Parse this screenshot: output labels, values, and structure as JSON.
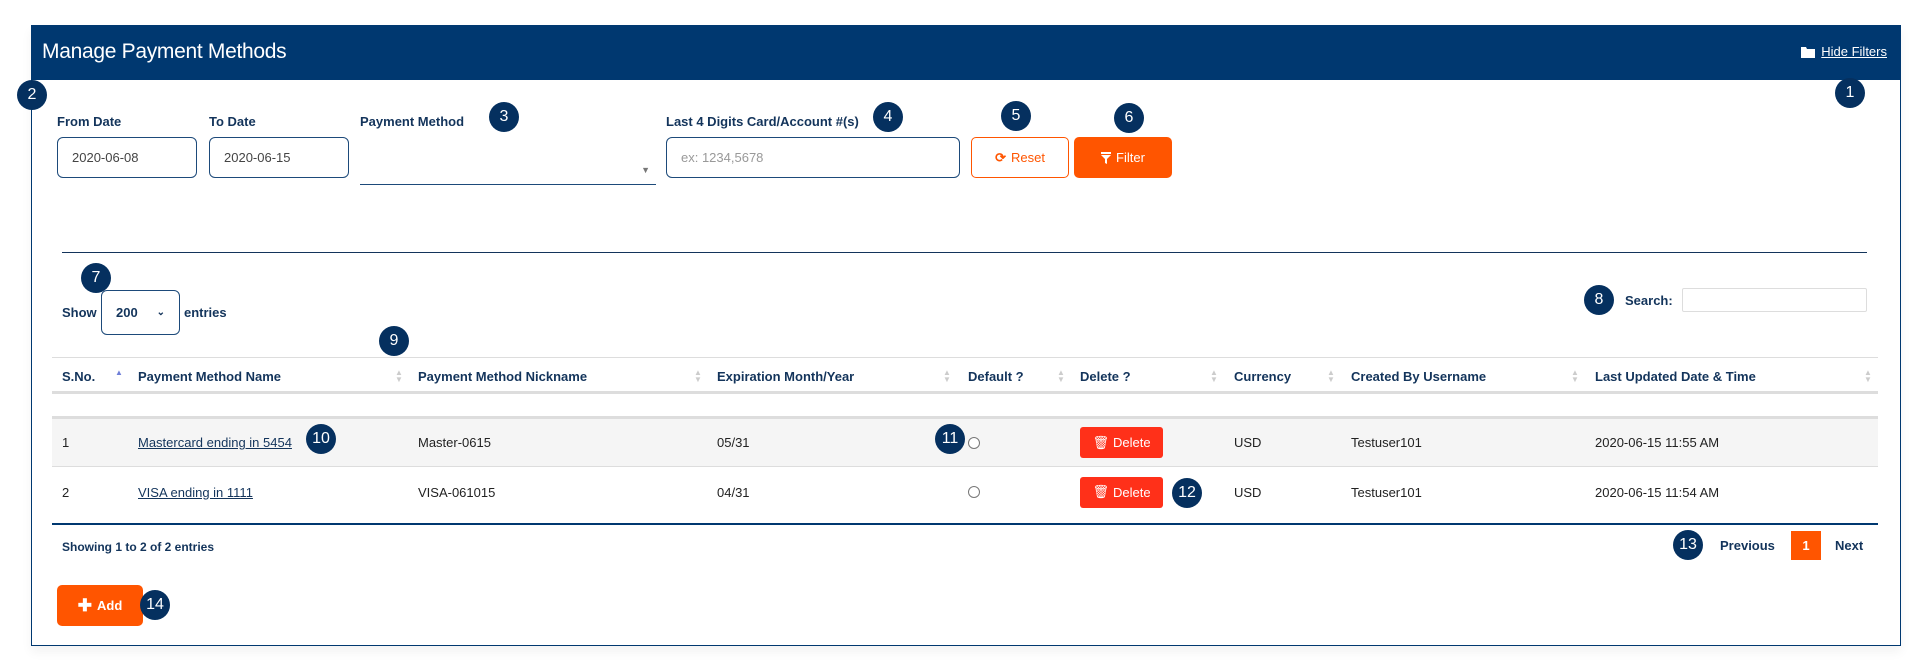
{
  "header": {
    "title": "Manage Payment Methods",
    "hide_filters": "Hide Filters"
  },
  "filters": {
    "from_date": {
      "label": "From Date",
      "value": "2020-06-08"
    },
    "to_date": {
      "label": "To Date",
      "value": "2020-06-15"
    },
    "payment_method": {
      "label": "Payment Method",
      "value": ""
    },
    "last4": {
      "label": "Last 4 Digits Card/Account #(s)",
      "placeholder": "ex: 1234,5678",
      "value": ""
    },
    "reset_label": "Reset",
    "filter_label": "Filter"
  },
  "table_controls": {
    "show": "Show",
    "page_size": "200",
    "entries": "entries",
    "search_label": "Search:",
    "search_value": ""
  },
  "table": {
    "columns": [
      "S.No.",
      "Payment Method Name",
      "Payment Method Nickname",
      "Expiration Month/Year",
      "Default ?",
      "Delete ?",
      "Currency",
      "Created By Username",
      "Last Updated Date & Time"
    ],
    "sorted_column": "S.No.",
    "rows": [
      {
        "sno": "1",
        "name": "Mastercard ending in 5454",
        "nickname": "Master-0615",
        "expiration": "05/31",
        "default": false,
        "delete_label": "Delete",
        "currency": "USD",
        "created_by": "Testuser101",
        "updated": "2020-06-15 11:55 AM"
      },
      {
        "sno": "2",
        "name": "VISA ending in 1111",
        "nickname": "VISA-061015",
        "expiration": "04/31",
        "default": false,
        "delete_label": "Delete",
        "currency": "USD",
        "created_by": "Testuser101",
        "updated": "2020-06-15 11:54 AM"
      }
    ]
  },
  "footer": {
    "info": "Showing 1 to 2 of 2 entries",
    "previous": "Previous",
    "current_page": "1",
    "next": "Next",
    "add_label": "Add"
  },
  "annotations": [
    "1",
    "2",
    "3",
    "4",
    "5",
    "6",
    "7",
    "8",
    "9",
    "10",
    "11",
    "12",
    "13",
    "14"
  ],
  "colors": {
    "navy": "#003870",
    "orange": "#ff5500",
    "delete_red": "#ff3019"
  }
}
